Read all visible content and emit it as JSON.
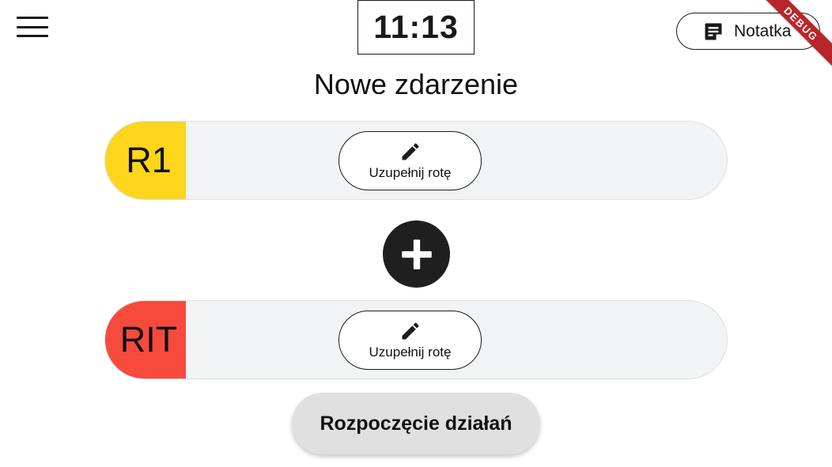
{
  "header": {
    "time": "11:13",
    "note_label": "Notatka",
    "debug_banner": "DEBUG"
  },
  "title": "Nowe zdarzenie",
  "rotas": [
    {
      "code": "R1",
      "color": "#fdd51b",
      "action_label": "Uzupełnij rotę",
      "icon": "pencil-icon"
    },
    {
      "code": "RIT",
      "color": "#f64a3d",
      "action_label": "Uzupełnij rotę",
      "icon": "pencil-icon"
    }
  ],
  "icons": {
    "menu": "hamburger-menu-icon",
    "note": "sticky-note-icon",
    "add": "plus-icon"
  },
  "start_label": "Rozpoczęcie działań",
  "colors": {
    "dark": "#1f1f1f",
    "card_bg": "#f1f3f5",
    "start_bg": "#e0e0e0",
    "debug": "#b8262b"
  }
}
